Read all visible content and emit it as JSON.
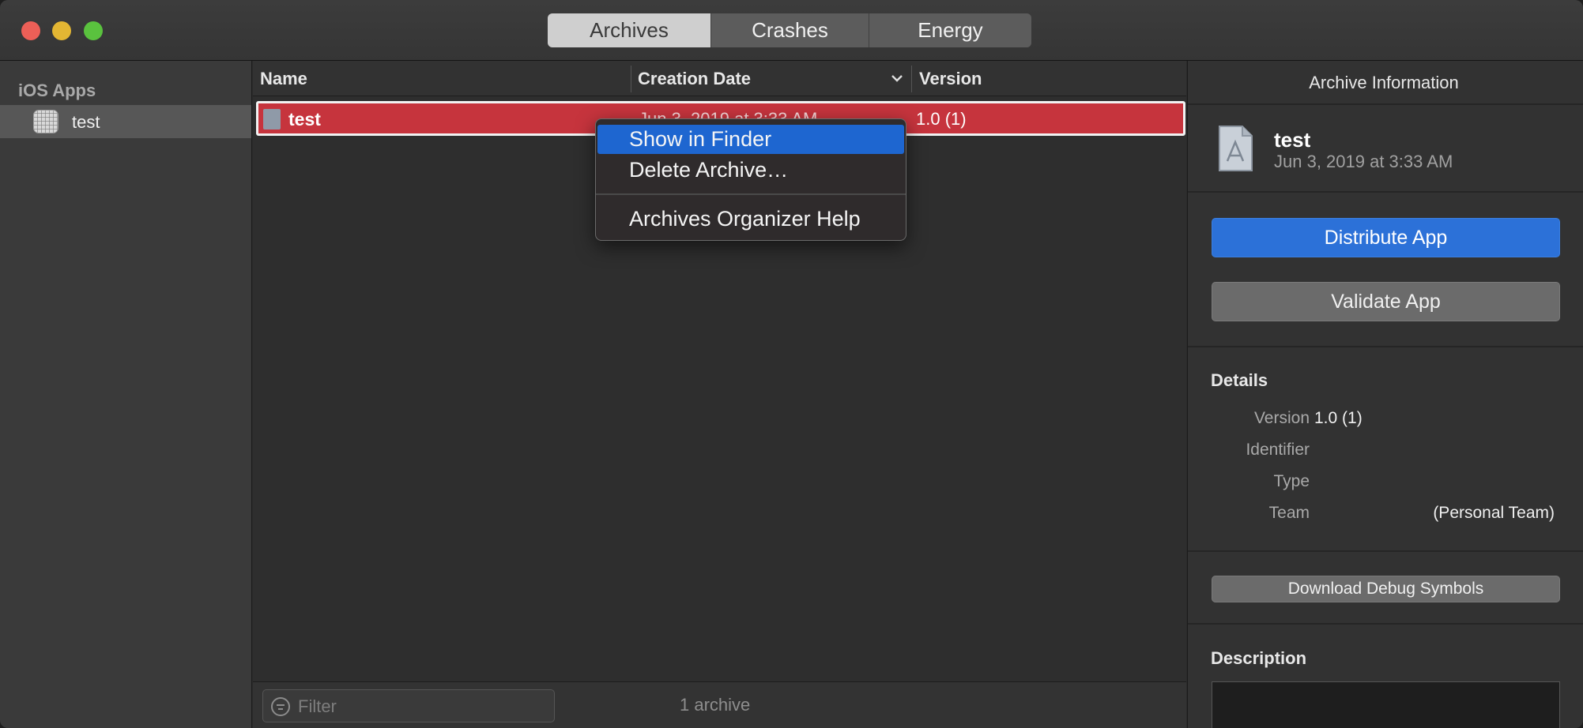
{
  "tabs": [
    {
      "label": "Archives",
      "active": true
    },
    {
      "label": "Crashes",
      "active": false
    },
    {
      "label": "Energy",
      "active": false
    }
  ],
  "sidebar": {
    "heading": "iOS Apps",
    "items": [
      {
        "label": "test",
        "icon": "app-grid-icon",
        "selected": true
      }
    ]
  },
  "list": {
    "columns": [
      "Name",
      "Creation Date",
      "Version"
    ],
    "sort_icon": "chevron-down-icon",
    "rows": [
      {
        "name": "test",
        "date": "Jun 3, 2019 at 3:33 AM",
        "version": "1.0 (1)",
        "selected": true
      }
    ]
  },
  "context_menu": {
    "items": [
      "Show in Finder",
      "Delete Archive…",
      "Archives Organizer Help"
    ],
    "highlighted": "Show in Finder"
  },
  "footer": {
    "filter_placeholder": "Filter",
    "archive_count": "1 archive"
  },
  "panel": {
    "title": "Archive Information",
    "archive_name": "test",
    "archive_date": "Jun 3, 2019 at 3:33 AM",
    "distribute_label": "Distribute App",
    "validate_label": "Validate App",
    "details_title": "Details",
    "details": {
      "version_label": "Version",
      "version_value": "1.0 (1)",
      "identifier_label": "Identifier",
      "type_label": "Type",
      "team_label": "Team",
      "team_value": "(Personal Team)"
    },
    "download_label": "Download Debug Symbols",
    "description_title": "Description"
  },
  "colors": {
    "selection_red": "#c6343d",
    "menu_highlight": "#1e66d0",
    "primary_button": "#2c71d8"
  }
}
